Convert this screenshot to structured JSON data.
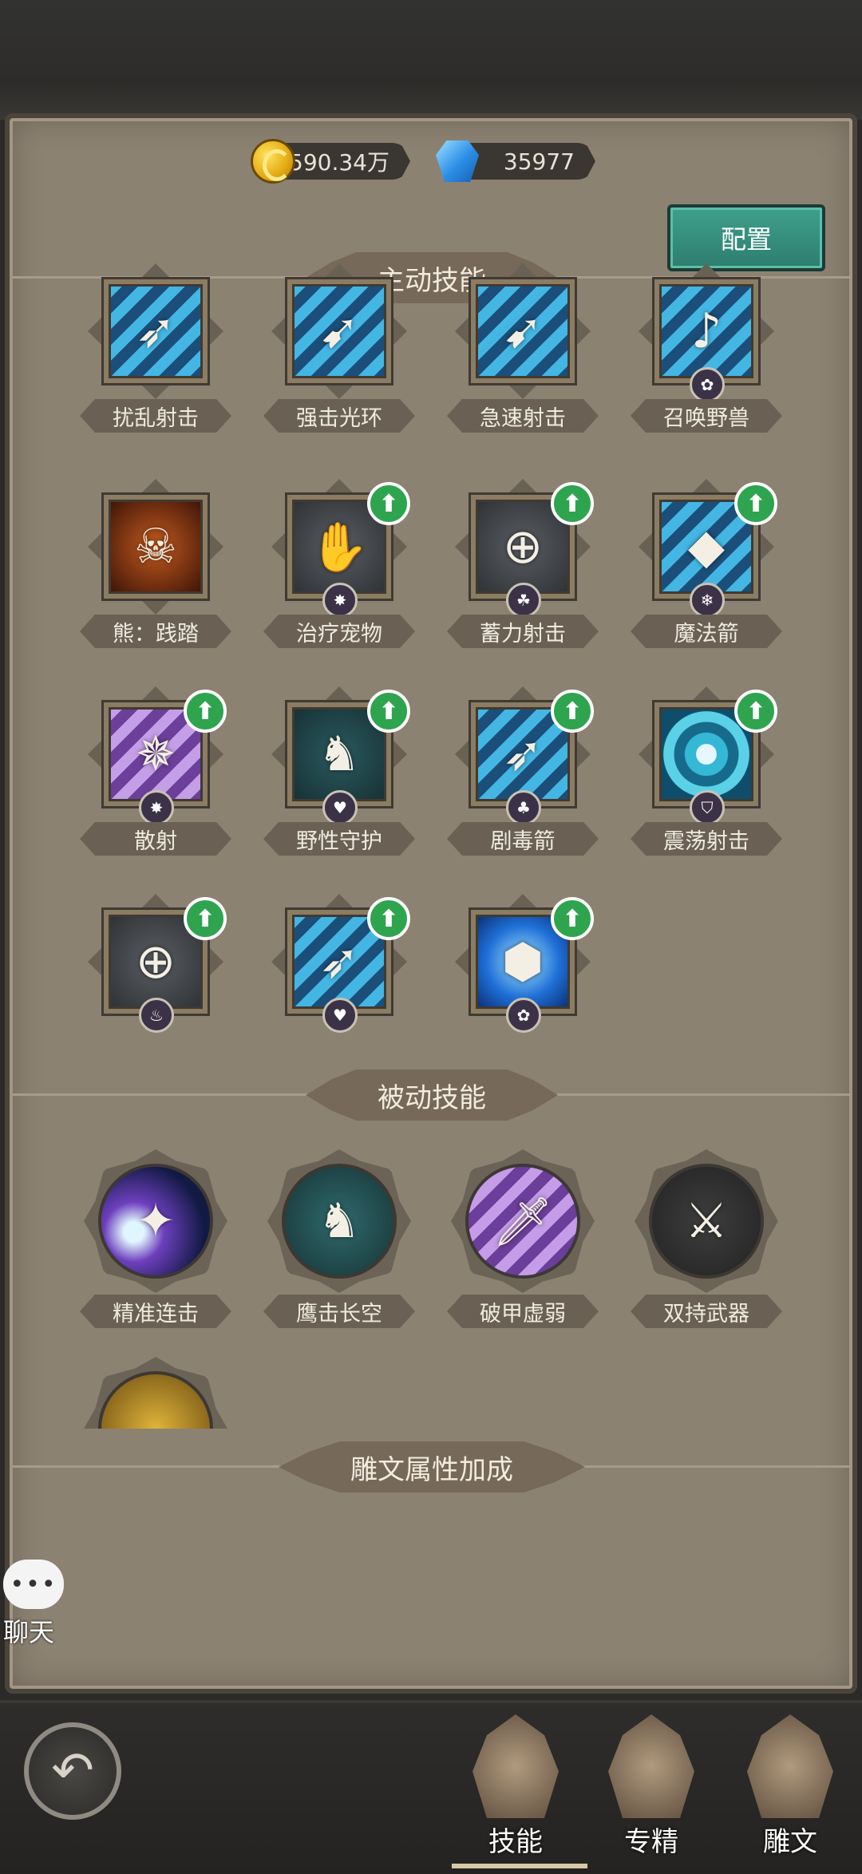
{
  "currency": {
    "gold": "4590.34万",
    "gems": "35977"
  },
  "config_label": "配置",
  "sections": {
    "active": "主动技能",
    "passive": "被动技能",
    "runes": "雕文属性加成"
  },
  "active_skills": [
    {
      "label": "扰乱射击",
      "art": "art-blue",
      "glyph": "➶",
      "upgrade": false,
      "rune": ""
    },
    {
      "label": "强击光环",
      "art": "art-blue",
      "glyph": "➹",
      "upgrade": false,
      "rune": ""
    },
    {
      "label": "急速射击",
      "art": "art-blue",
      "glyph": "➹",
      "upgrade": false,
      "rune": ""
    },
    {
      "label": "召唤野兽",
      "art": "art-blue",
      "glyph": "♪",
      "upgrade": false,
      "rune": "✿"
    },
    {
      "label": "熊：践踏",
      "art": "art-fire",
      "glyph": "☠",
      "upgrade": false,
      "rune": ""
    },
    {
      "label": "治疗宠物",
      "art": "art-dark",
      "glyph": "✋",
      "upgrade": true,
      "rune": "✸"
    },
    {
      "label": "蓄力射击",
      "art": "art-dark",
      "glyph": "⊕",
      "upgrade": true,
      "rune": "☘"
    },
    {
      "label": "魔法箭",
      "art": "art-blue",
      "glyph": "◆",
      "upgrade": true,
      "rune": "❄"
    },
    {
      "label": "散射",
      "art": "art-purple",
      "glyph": "✵",
      "upgrade": true,
      "rune": "✸"
    },
    {
      "label": "野性守护",
      "art": "art-cyan",
      "glyph": "♞",
      "upgrade": true,
      "rune": "♥"
    },
    {
      "label": "剧毒箭",
      "art": "art-blue",
      "glyph": "➶",
      "upgrade": true,
      "rune": "♣"
    },
    {
      "label": "震荡射击",
      "art": "art-swirl",
      "glyph": "",
      "upgrade": true,
      "rune": "⛉"
    },
    {
      "label": "",
      "art": "art-dark",
      "glyph": "⊕",
      "upgrade": true,
      "rune": "♨"
    },
    {
      "label": "",
      "art": "art-blue",
      "glyph": "➶",
      "upgrade": true,
      "rune": "♥"
    },
    {
      "label": "",
      "art": "art-crystal",
      "glyph": "⬢",
      "upgrade": true,
      "rune": "✿"
    }
  ],
  "passive_skills": [
    {
      "label": "精准连击",
      "art": "p-star",
      "glyph": "✦"
    },
    {
      "label": "鹰击长空",
      "art": "p-cyan",
      "glyph": "♞"
    },
    {
      "label": "破甲虚弱",
      "art": "p-dagger",
      "glyph": "🗡"
    },
    {
      "label": "双持武器",
      "art": "p-swords",
      "glyph": "⚔"
    },
    {
      "label": "",
      "art": "p-gold",
      "glyph": ""
    }
  ],
  "chat": {
    "dots": "•••",
    "label": "聊天"
  },
  "nav": {
    "back": "↶",
    "tabs": [
      {
        "label": "技能",
        "active": true
      },
      {
        "label": "专精",
        "active": false
      },
      {
        "label": "雕文",
        "active": false
      }
    ]
  }
}
